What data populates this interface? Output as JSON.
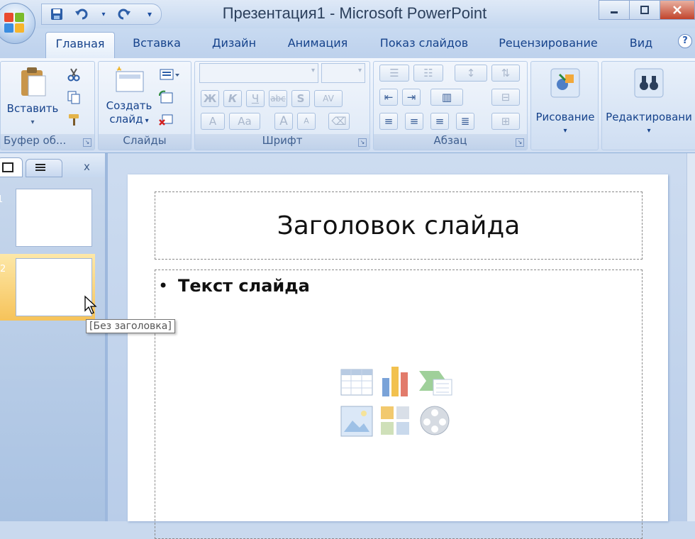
{
  "window": {
    "title": "Презентация1 - Microsoft PowerPoint",
    "controls": {
      "minimize": "—",
      "maximize": "□",
      "close": "x"
    }
  },
  "quick_access": [
    "save-icon",
    "undo-icon",
    "dropdown-icon",
    "redo-icon",
    "customize-icon"
  ],
  "tabs": [
    {
      "label": "Главная",
      "active": true
    },
    {
      "label": "Вставка"
    },
    {
      "label": "Дизайн"
    },
    {
      "label": "Анимация"
    },
    {
      "label": "Показ слайдов"
    },
    {
      "label": "Рецензирование"
    },
    {
      "label": "Вид"
    }
  ],
  "ribbon": {
    "clipboard": {
      "label": "Буфер об...",
      "paste_label": "Вставить"
    },
    "slides": {
      "label": "Слайды",
      "new_slide_line1": "Создать",
      "new_slide_line2": "слайд"
    },
    "font": {
      "label": "Шрифт",
      "bold": "Ж",
      "italic": "К",
      "underline": "Ч",
      "strike": "abc",
      "shadow": "S",
      "spacing": "AV",
      "grow": "A",
      "shrink": "A",
      "case": "Aa",
      "color": "A"
    },
    "paragraph": {
      "label": "Абзац"
    },
    "drawing": {
      "label": "Рисование"
    },
    "editing": {
      "label": "Редактировани"
    }
  },
  "help": "?",
  "pane": {
    "close": "x",
    "slides": [
      {
        "number": "1"
      },
      {
        "number": "2",
        "selected": true
      }
    ]
  },
  "tooltip": "[Без заголовка]",
  "slide": {
    "title": "Заголовок слайда",
    "bullet": "•",
    "body": "Текст слайда"
  },
  "colors": {
    "accent": "#15428b",
    "ribbon": "#dde8f6",
    "selected_thumb": "#f8c767",
    "close_button": "#c1442c"
  }
}
